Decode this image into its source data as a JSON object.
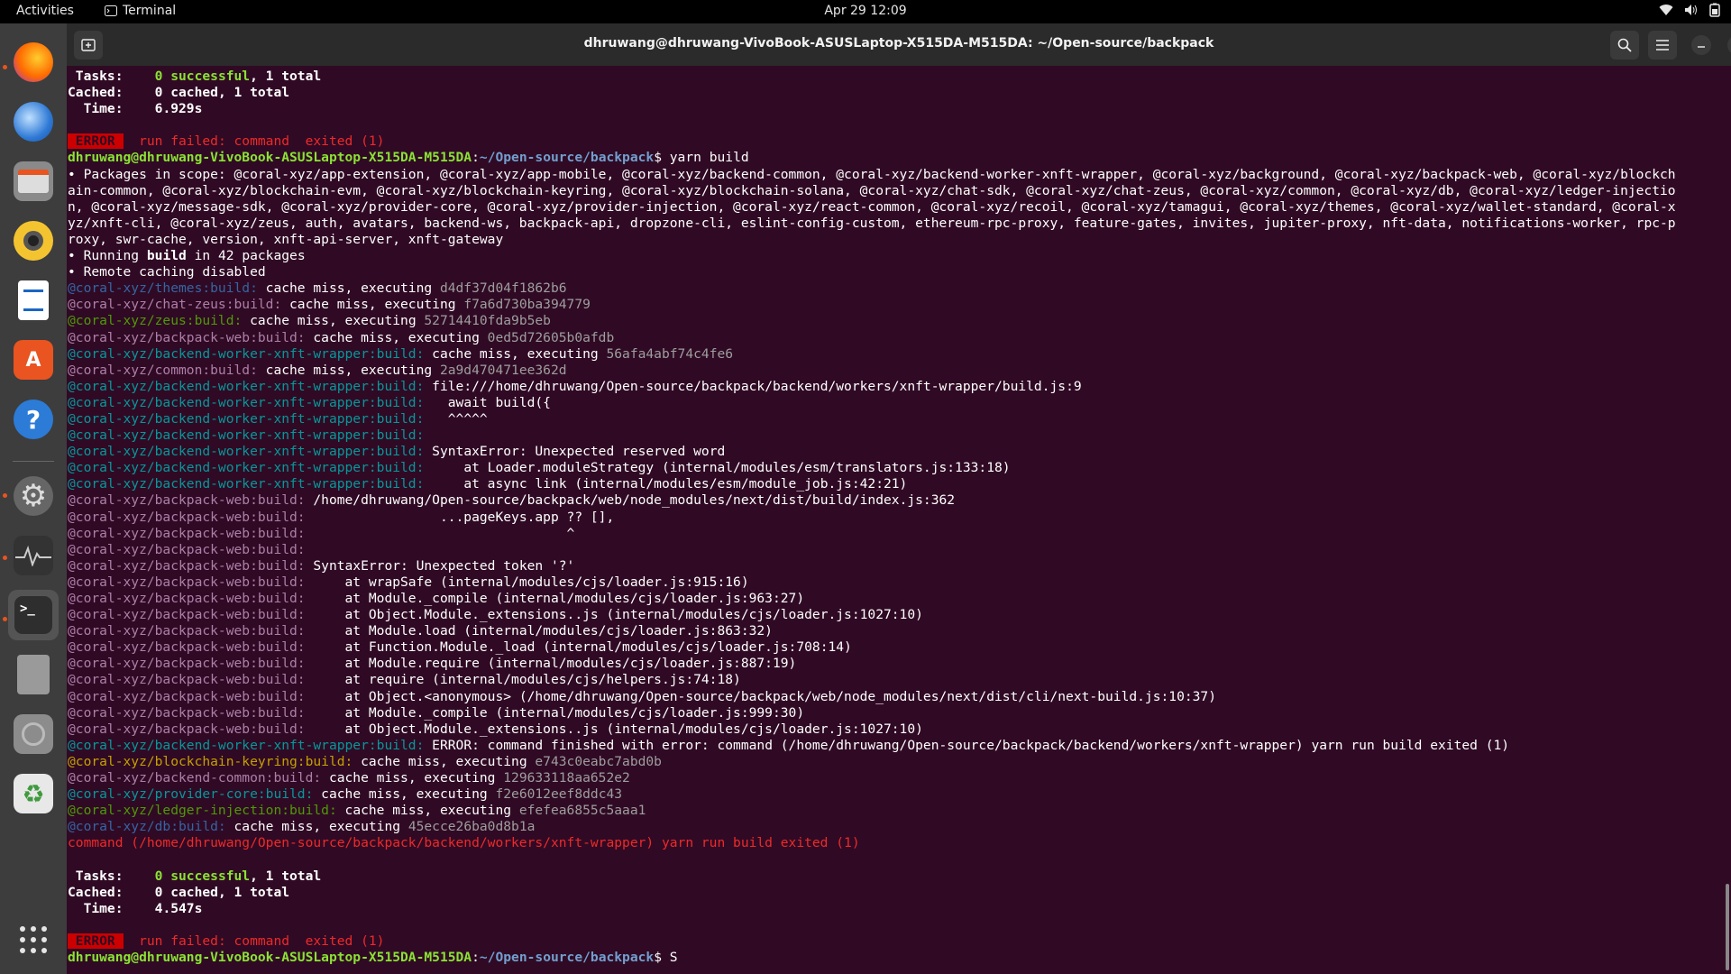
{
  "topbar": {
    "activities": "Activities",
    "app_name": "Terminal",
    "clock": "Apr 29  12:09"
  },
  "dock": {
    "items": [
      {
        "name": "firefox-icon",
        "glyph": "",
        "color": "#e66000"
      },
      {
        "name": "thunderbird-icon",
        "glyph": "",
        "color": "#2f7ad6"
      },
      {
        "name": "files-icon",
        "glyph": "",
        "color": "#8a8a8a"
      },
      {
        "name": "rhythmbox-icon",
        "glyph": "",
        "color": "#f4c430"
      },
      {
        "name": "libreoffice-writer-icon",
        "glyph": "",
        "color": "#1a66c4"
      },
      {
        "name": "ubuntu-software-icon",
        "glyph": "A",
        "color": "#e95420"
      },
      {
        "name": "help-icon",
        "glyph": "?",
        "color": "#2c7bd6"
      },
      {
        "name": "settings-icon",
        "glyph": "⚙",
        "color": "#777"
      },
      {
        "name": "system-monitor-icon",
        "glyph": "",
        "color": "#333"
      },
      {
        "name": "terminal-icon",
        "glyph": ">_",
        "color": "#2e2e2e"
      },
      {
        "name": "text-editor-icon",
        "glyph": "",
        "color": "#9a9a9a"
      },
      {
        "name": "disk-icon",
        "glyph": "",
        "color": "#8c8c8c"
      },
      {
        "name": "trash-icon",
        "glyph": "♻",
        "color": "#5a9a5a"
      }
    ],
    "apps_grid": "show-apps"
  },
  "window": {
    "title": "dhruwang@dhruwang-VivoBook-ASUSLaptop-X515DA-M515DA: ~/Open-source/backpack"
  },
  "terminal": {
    "lines": [
      [
        [
          "b",
          " Tasks:    "
        ],
        [
          "gb",
          "0 successful"
        ],
        [
          "b",
          ", 1 total"
        ]
      ],
      [
        [
          "b",
          "Cached:    0 cached"
        ],
        [
          "b",
          ", 1 total"
        ]
      ],
      [
        [
          "b",
          "  Time:    "
        ],
        [
          "b",
          "6.929s"
        ]
      ],
      [
        [
          "w",
          ""
        ]
      ],
      [
        [
          "err",
          " ERROR "
        ],
        [
          "r",
          "  run failed: command  exited (1)"
        ]
      ],
      [
        [
          "gb",
          "dhruwang@dhruwang-VivoBook-ASUSLaptop-X515DA-M515DA"
        ],
        [
          "w",
          ":"
        ],
        [
          "bb",
          "~/Open-source/backpack"
        ],
        [
          "w",
          "$ yarn build"
        ]
      ],
      [
        [
          "w",
          "• Packages in scope: @coral-xyz/app-extension, @coral-xyz/app-mobile, @coral-xyz/backend-common, @coral-xyz/backend-worker-xnft-wrapper, @coral-xyz/background, @coral-xyz/backpack-web, @coral-xyz/blockch"
        ]
      ],
      [
        [
          "w",
          "ain-common, @coral-xyz/blockchain-evm, @coral-xyz/blockchain-keyring, @coral-xyz/blockchain-solana, @coral-xyz/chat-sdk, @coral-xyz/chat-zeus, @coral-xyz/common, @coral-xyz/db, @coral-xyz/ledger-injectio"
        ]
      ],
      [
        [
          "w",
          "n, @coral-xyz/message-sdk, @coral-xyz/provider-core, @coral-xyz/provider-injection, @coral-xyz/react-common, @coral-xyz/recoil, @coral-xyz/tamagui, @coral-xyz/themes, @coral-xyz/wallet-standard, @coral-x"
        ]
      ],
      [
        [
          "w",
          "yz/xnft-cli, @coral-xyz/zeus, auth, avatars, backend-ws, backpack-api, dropzone-cli, eslint-config-custom, ethereum-rpc-proxy, feature-gates, invites, jupiter-proxy, nft-data, notifications-worker, rpc-p"
        ]
      ],
      [
        [
          "w",
          "roxy, swr-cache, version, xnft-api-server, xnft-gateway"
        ]
      ],
      [
        [
          "w",
          "• Running "
        ],
        [
          "b",
          "build"
        ],
        [
          "w",
          " in 42 packages"
        ]
      ],
      [
        [
          "w",
          "• Remote caching disabled"
        ]
      ],
      [
        [
          "bl",
          "@coral-xyz/themes:build: "
        ],
        [
          "w",
          "cache miss, executing "
        ],
        [
          "dg",
          "d4df37d04f1862b6"
        ]
      ],
      [
        [
          "mag",
          "@coral-xyz/chat-zeus:build: "
        ],
        [
          "w",
          "cache miss, executing "
        ],
        [
          "dg",
          "f7a6d730ba394779"
        ]
      ],
      [
        [
          "g",
          "@coral-xyz/zeus:build: "
        ],
        [
          "w",
          "cache miss, executing "
        ],
        [
          "dg",
          "52714410fda9b5eb"
        ]
      ],
      [
        [
          "mag",
          "@coral-xyz/backpack-web:build: "
        ],
        [
          "w",
          "cache miss, executing "
        ],
        [
          "dg",
          "0ed5d72605b0afdb"
        ]
      ],
      [
        [
          "cyan",
          "@coral-xyz/backend-worker-xnft-wrapper:build: "
        ],
        [
          "w",
          "cache miss, executing "
        ],
        [
          "dg",
          "56afa4abf74c4fe6"
        ]
      ],
      [
        [
          "mag",
          "@coral-xyz/common:build: "
        ],
        [
          "w",
          "cache miss, executing "
        ],
        [
          "dg",
          "2a9d470471ee362d"
        ]
      ],
      [
        [
          "cyan",
          "@coral-xyz/backend-worker-xnft-wrapper:build: "
        ],
        [
          "w",
          "file:///home/dhruwang/Open-source/backpack/backend/workers/xnft-wrapper/build.js:9"
        ]
      ],
      [
        [
          "cyan",
          "@coral-xyz/backend-worker-xnft-wrapper:build: "
        ],
        [
          "w",
          "  await build({"
        ]
      ],
      [
        [
          "cyan",
          "@coral-xyz/backend-worker-xnft-wrapper:build: "
        ],
        [
          "w",
          "  ^^^^^"
        ]
      ],
      [
        [
          "cyan",
          "@coral-xyz/backend-worker-xnft-wrapper:build: "
        ]
      ],
      [
        [
          "cyan",
          "@coral-xyz/backend-worker-xnft-wrapper:build: "
        ],
        [
          "w",
          "SyntaxError: Unexpected reserved word"
        ]
      ],
      [
        [
          "cyan",
          "@coral-xyz/backend-worker-xnft-wrapper:build: "
        ],
        [
          "w",
          "    at Loader.moduleStrategy (internal/modules/esm/translators.js:133:18)"
        ]
      ],
      [
        [
          "cyan",
          "@coral-xyz/backend-worker-xnft-wrapper:build: "
        ],
        [
          "w",
          "    at async link (internal/modules/esm/module_job.js:42:21)"
        ]
      ],
      [
        [
          "mag",
          "@coral-xyz/backpack-web:build: "
        ],
        [
          "w",
          "/home/dhruwang/Open-source/backpack/web/node_modules/next/dist/build/index.js:362"
        ]
      ],
      [
        [
          "mag",
          "@coral-xyz/backpack-web:build: "
        ],
        [
          "w",
          "                ...pageKeys.app ?? [],"
        ]
      ],
      [
        [
          "mag",
          "@coral-xyz/backpack-web:build: "
        ],
        [
          "w",
          "                                ^"
        ]
      ],
      [
        [
          "mag",
          "@coral-xyz/backpack-web:build: "
        ]
      ],
      [
        [
          "mag",
          "@coral-xyz/backpack-web:build: "
        ],
        [
          "w",
          "SyntaxError: Unexpected token '?'"
        ]
      ],
      [
        [
          "mag",
          "@coral-xyz/backpack-web:build: "
        ],
        [
          "w",
          "    at wrapSafe (internal/modules/cjs/loader.js:915:16)"
        ]
      ],
      [
        [
          "mag",
          "@coral-xyz/backpack-web:build: "
        ],
        [
          "w",
          "    at Module._compile (internal/modules/cjs/loader.js:963:27)"
        ]
      ],
      [
        [
          "mag",
          "@coral-xyz/backpack-web:build: "
        ],
        [
          "w",
          "    at Object.Module._extensions..js (internal/modules/cjs/loader.js:1027:10)"
        ]
      ],
      [
        [
          "mag",
          "@coral-xyz/backpack-web:build: "
        ],
        [
          "w",
          "    at Module.load (internal/modules/cjs/loader.js:863:32)"
        ]
      ],
      [
        [
          "mag",
          "@coral-xyz/backpack-web:build: "
        ],
        [
          "w",
          "    at Function.Module._load (internal/modules/cjs/loader.js:708:14)"
        ]
      ],
      [
        [
          "mag",
          "@coral-xyz/backpack-web:build: "
        ],
        [
          "w",
          "    at Module.require (internal/modules/cjs/loader.js:887:19)"
        ]
      ],
      [
        [
          "mag",
          "@coral-xyz/backpack-web:build: "
        ],
        [
          "w",
          "    at require (internal/modules/cjs/helpers.js:74:18)"
        ]
      ],
      [
        [
          "mag",
          "@coral-xyz/backpack-web:build: "
        ],
        [
          "w",
          "    at Object.<anonymous> (/home/dhruwang/Open-source/backpack/web/node_modules/next/dist/cli/next-build.js:10:37)"
        ]
      ],
      [
        [
          "mag",
          "@coral-xyz/backpack-web:build: "
        ],
        [
          "w",
          "    at Module._compile (internal/modules/cjs/loader.js:999:30)"
        ]
      ],
      [
        [
          "mag",
          "@coral-xyz/backpack-web:build: "
        ],
        [
          "w",
          "    at Object.Module._extensions..js (internal/modules/cjs/loader.js:1027:10)"
        ]
      ],
      [
        [
          "cyan",
          "@coral-xyz/backend-worker-xnft-wrapper:build: "
        ],
        [
          "w",
          "ERROR: command finished with error: command (/home/dhruwang/Open-source/backpack/backend/workers/xnft-wrapper) yarn run build exited (1)"
        ]
      ],
      [
        [
          "yel",
          "@coral-xyz/blockchain-keyring:build: "
        ],
        [
          "w",
          "cache miss, executing "
        ],
        [
          "dg",
          "e743c0eabc7abd0b"
        ]
      ],
      [
        [
          "mag",
          "@coral-xyz/backend-common:build: "
        ],
        [
          "w",
          "cache miss, executing "
        ],
        [
          "dg",
          "129633118aa652e2"
        ]
      ],
      [
        [
          "cyan",
          "@coral-xyz/provider-core:build: "
        ],
        [
          "w",
          "cache miss, executing "
        ],
        [
          "dg",
          "f2e6012eef8ddc43"
        ]
      ],
      [
        [
          "g",
          "@coral-xyz/ledger-injection:build: "
        ],
        [
          "w",
          "cache miss, executing "
        ],
        [
          "dg",
          "efefea6855c5aaa1"
        ]
      ],
      [
        [
          "bl",
          "@coral-xyz/db:build: "
        ],
        [
          "w",
          "cache miss, executing "
        ],
        [
          "dg",
          "45ecce26ba0d8b1a"
        ]
      ],
      [
        [
          "r",
          "command (/home/dhruwang/Open-source/backpack/backend/workers/xnft-wrapper) yarn run build exited (1)"
        ]
      ],
      [
        [
          "w",
          ""
        ]
      ],
      [
        [
          "b",
          " Tasks:    "
        ],
        [
          "gb",
          "0 successful"
        ],
        [
          "b",
          ", 1 total"
        ]
      ],
      [
        [
          "b",
          "Cached:    0 cached"
        ],
        [
          "b",
          ", 1 total"
        ]
      ],
      [
        [
          "b",
          "  Time:    "
        ],
        [
          "b",
          "4.547s"
        ]
      ],
      [
        [
          "w",
          ""
        ]
      ],
      [
        [
          "err",
          " ERROR "
        ],
        [
          "r",
          "  run failed: command  exited (1)"
        ]
      ],
      [
        [
          "gb",
          "dhruwang@dhruwang-VivoBook-ASUSLaptop-X515DA-M515DA"
        ],
        [
          "w",
          ":"
        ],
        [
          "bb",
          "~/Open-source/backpack"
        ],
        [
          "w",
          "$ S"
        ]
      ]
    ]
  }
}
